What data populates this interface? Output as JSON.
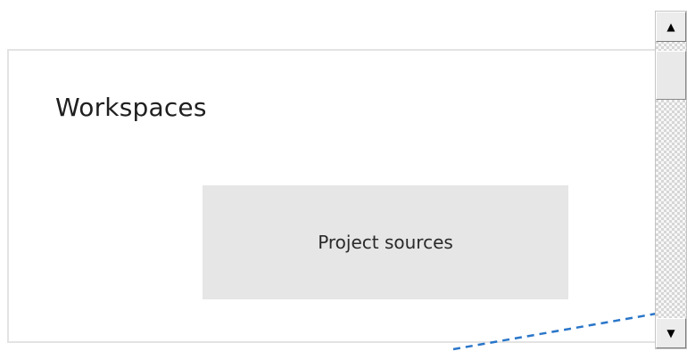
{
  "workspaces": {
    "title": "Workspaces",
    "items": [
      {
        "label": "Project sources"
      }
    ]
  },
  "scrollbar": {
    "up_icon": "triangle-up-icon",
    "down_icon": "triangle-down-icon"
  },
  "colors": {
    "panel_border": "#e3e3e3",
    "box_fill": "#e6e6e6",
    "connector": "#2a76c9"
  }
}
